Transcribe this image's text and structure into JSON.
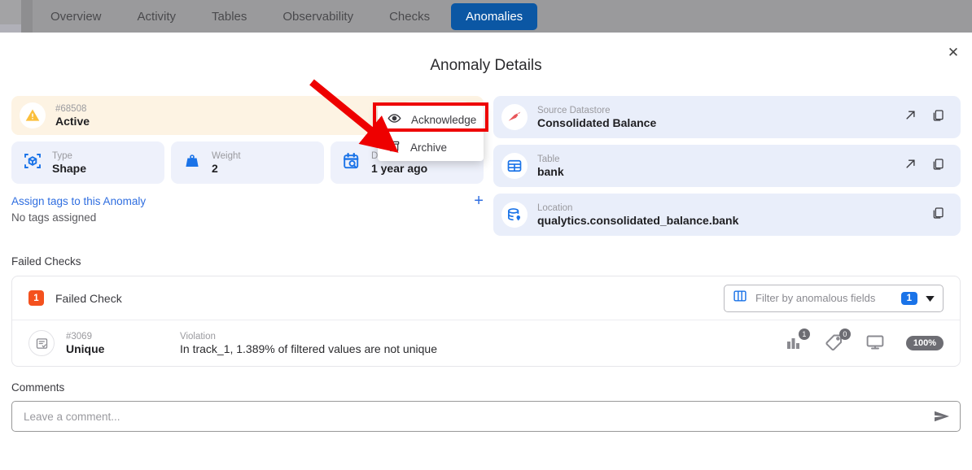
{
  "nav": {
    "tabs": [
      {
        "label": "Overview",
        "active": false
      },
      {
        "label": "Activity",
        "active": false
      },
      {
        "label": "Tables",
        "active": false
      },
      {
        "label": "Observability",
        "active": false
      },
      {
        "label": "Checks",
        "active": false
      },
      {
        "label": "Anomalies",
        "active": true
      }
    ]
  },
  "modal": {
    "title": "Anomaly Details",
    "close_label": "✕"
  },
  "status": {
    "id": "#68508",
    "state": "Active",
    "icon": "warning-triangle-icon",
    "actions": {
      "share": "share-icon",
      "key": "key-icon",
      "more": "kebab-menu-icon"
    }
  },
  "menu": {
    "items": [
      {
        "label": "Acknowledge",
        "icon": "eye-icon",
        "highlighted": true
      },
      {
        "label": "Archive",
        "icon": "archive-icon",
        "highlighted": false
      }
    ]
  },
  "metrics": [
    {
      "label": "Type",
      "value": "Shape",
      "icon": "shape-cube-icon"
    },
    {
      "label": "Weight",
      "value": "2",
      "icon": "weight-icon"
    },
    {
      "label": "Detected",
      "value": "1 year ago",
      "icon": "calendar-search-icon"
    }
  ],
  "tags": {
    "link": "Assign tags to this Anomaly",
    "empty": "No tags assigned",
    "add": "+"
  },
  "info_rows": [
    {
      "label": "Source Datastore",
      "value": "Consolidated Balance",
      "icon": "datastore-icon",
      "has_open": true,
      "has_copy": true
    },
    {
      "label": "Table",
      "value": "bank",
      "icon": "table-grid-icon",
      "has_open": true,
      "has_copy": true
    },
    {
      "label": "Location",
      "value": "qualytics.consolidated_balance.bank",
      "icon": "database-location-icon",
      "has_open": false,
      "has_copy": true
    }
  ],
  "failed_checks": {
    "section_label": "Failed Checks",
    "count": "1",
    "header_title": "Failed Check",
    "filter": {
      "placeholder": "Filter by anomalous fields",
      "count": "1",
      "icon": "columns-icon",
      "chevron": "chevron-down-icon"
    },
    "columns": {
      "id": "#3069",
      "violation_label": "Violation"
    },
    "rows": [
      {
        "id": "#3069",
        "name": "Unique",
        "violation_label": "Violation",
        "violation": "In track_1, 1.389% of filtered values are not unique",
        "fields_count": "1",
        "tags_count": "0",
        "percent": "100%"
      }
    ]
  },
  "comments": {
    "label": "Comments",
    "placeholder": "Leave a comment...",
    "value": "",
    "send_icon": "send-icon"
  },
  "colors": {
    "accent_blue": "#1a73e8",
    "tab_active": "#0b57a4",
    "banner_bg": "#fdf3e3",
    "info_bg": "#e9eefa",
    "badge_orange": "#f4511e",
    "annotation_red": "#ee0000"
  }
}
